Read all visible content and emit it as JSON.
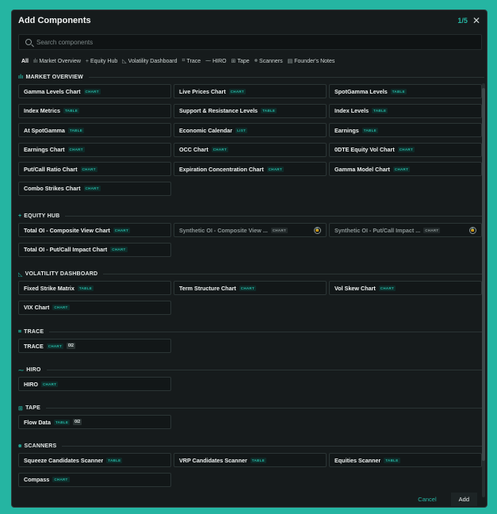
{
  "modal": {
    "title": "Add Components",
    "counter": "1/5",
    "close_glyph": "✕",
    "close_icon": "close-icon"
  },
  "search": {
    "placeholder": "Search components",
    "value": ""
  },
  "filters": [
    {
      "label": "All",
      "icon": ""
    },
    {
      "label": "Market Overview",
      "icon": "ılı"
    },
    {
      "label": "Equity Hub",
      "icon": "+"
    },
    {
      "label": "Volatility Dashboard",
      "icon": "◺"
    },
    {
      "label": "Trace",
      "icon": "⌗"
    },
    {
      "label": "HIRO",
      "icon": "⁓"
    },
    {
      "label": "Tape",
      "icon": "⊞"
    },
    {
      "label": "Scanners",
      "icon": "⨳"
    },
    {
      "label": "Founder's Notes",
      "icon": "▤"
    }
  ],
  "sections": {
    "market_overview": {
      "title": "MARKET OVERVIEW",
      "icon": "ılı",
      "items": [
        {
          "label": "Gamma Levels Chart",
          "tag": "CHART"
        },
        {
          "label": "Live Prices Chart",
          "tag": "CHART"
        },
        {
          "label": "SpotGamma Levels",
          "tag": "TABLE"
        },
        {
          "label": "Index Metrics",
          "tag": "TABLE"
        },
        {
          "label": "Support & Resistance Levels",
          "tag": "TABLE"
        },
        {
          "label": "Index Levels",
          "tag": "TABLE"
        },
        {
          "label": "At SpotGamma",
          "tag": "TABLE"
        },
        {
          "label": "Economic Calendar",
          "tag": "LIST"
        },
        {
          "label": "Earnings",
          "tag": "TABLE"
        },
        {
          "label": "Earnings Chart",
          "tag": "CHART"
        },
        {
          "label": "OCC Chart",
          "tag": "CHART"
        },
        {
          "label": "0DTE Equity Vol Chart",
          "tag": "CHART"
        },
        {
          "label": "Put/Call Ratio Chart",
          "tag": "CHART"
        },
        {
          "label": "Expiration Concentration Chart",
          "tag": "CHART"
        },
        {
          "label": "Gamma Model Chart",
          "tag": "CHART"
        },
        {
          "label": "Combo Strikes Chart",
          "tag": "CHART"
        }
      ]
    },
    "equity_hub": {
      "title": "EQUITY HUB",
      "icon": "+",
      "items": [
        {
          "label": "Total OI - Composite View Chart",
          "tag": "CHART"
        },
        {
          "label": "Synthetic OI - Composite View ...",
          "tag": "CHART",
          "locked": true
        },
        {
          "label": "Synthetic OI - Put/Call Impact ...",
          "tag": "CHART",
          "locked": true
        },
        {
          "label": "Total OI - Put/Call Impact Chart",
          "tag": "CHART"
        }
      ]
    },
    "volatility_dashboard": {
      "title": "VOLATILITY DASHBOARD",
      "icon": "◺",
      "items": [
        {
          "label": "Fixed Strike Matrix",
          "tag": "TABLE"
        },
        {
          "label": "Term Structure Chart",
          "tag": "CHART"
        },
        {
          "label": "Vol Skew Chart",
          "tag": "CHART"
        },
        {
          "label": "VIX Chart",
          "tag": "CHART"
        }
      ]
    },
    "trace": {
      "title": "TRACE",
      "icon": "⌗",
      "items": [
        {
          "label": "TRACE",
          "tag": "CHART",
          "count": "0/2"
        }
      ]
    },
    "hiro": {
      "title": "HIRO",
      "icon": "⁓",
      "items": [
        {
          "label": "HIRO",
          "tag": "CHART"
        }
      ]
    },
    "tape": {
      "title": "TAPE",
      "icon": "⊞",
      "items": [
        {
          "label": "Flow Data",
          "tag": "TABLE",
          "count": "0/2"
        }
      ]
    },
    "scanners": {
      "title": "SCANNERS",
      "icon": "⨳",
      "items": [
        {
          "label": "Squeeze Candidates Scanner",
          "tag": "TABLE"
        },
        {
          "label": "VRP Candidates Scanner",
          "tag": "TABLE"
        },
        {
          "label": "Equities Scanner",
          "tag": "TABLE"
        },
        {
          "label": "Compass",
          "tag": "CHART"
        }
      ]
    }
  },
  "footer": {
    "cancel_label": "Cancel",
    "add_label": "Add"
  },
  "colors": {
    "accent": "#25b5a2",
    "background": "#161b1c",
    "card_border": "#2b3535"
  }
}
